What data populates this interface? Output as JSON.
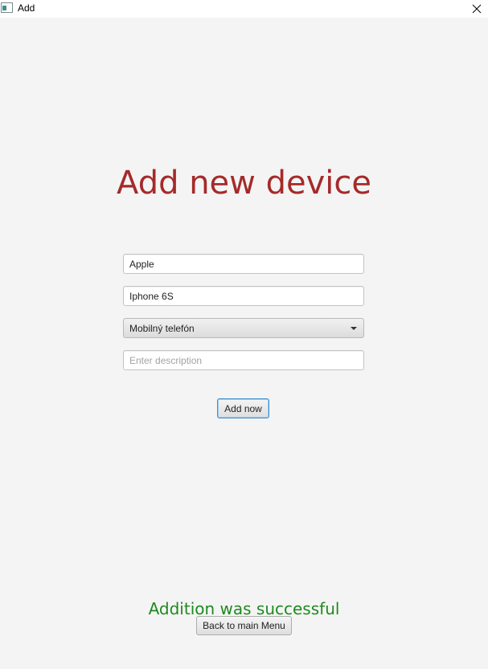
{
  "window": {
    "title": "Add",
    "close_glyph": "×"
  },
  "page": {
    "title": "Add new device"
  },
  "form": {
    "brand_value": "Apple",
    "model_value": "Iphone 6S",
    "category_selected": "Mobilný telefón",
    "description_value": "",
    "description_placeholder": "Enter description",
    "add_button_label": "Add now"
  },
  "status": {
    "message": "Addition was successful",
    "color": "#1e8a1e"
  },
  "footer": {
    "back_button_label": "Back to main Menu"
  },
  "colors": {
    "title": "#a52a2a",
    "background": "#f4f4f4",
    "focus_border": "#3c8fce"
  },
  "icons": {
    "app": "app-window-icon",
    "close": "close-icon",
    "dropdown": "chevron-down-icon"
  }
}
